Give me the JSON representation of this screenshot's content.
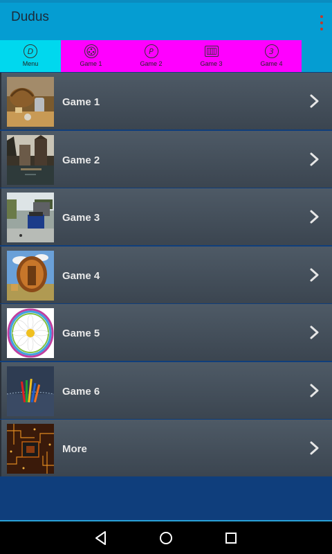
{
  "app": {
    "title": "Dudus"
  },
  "tabs": [
    {
      "label": "Menu",
      "icon_glyph": "D",
      "icon": "circle-d-icon"
    },
    {
      "label": "Game 1",
      "icon_glyph": "",
      "icon": "ball-icon"
    },
    {
      "label": "Game 2",
      "icon_glyph": "P",
      "icon": "circle-p-icon"
    },
    {
      "label": "Game 3",
      "icon_glyph": "",
      "icon": "grid-icon"
    },
    {
      "label": "Game 4",
      "icon_glyph": "3",
      "icon": "circle-3-icon"
    }
  ],
  "list": [
    {
      "label": "Game 1",
      "thumb": "basket-picnic-image"
    },
    {
      "label": "Game 2",
      "thumb": "canal-town-image"
    },
    {
      "label": "Game 3",
      "thumb": "street-cart-image"
    },
    {
      "label": "Game 4",
      "thumb": "barrel-sauna-image"
    },
    {
      "label": "Game 5",
      "thumb": "daisy-image"
    },
    {
      "label": "Game 6",
      "thumb": "pencils-jeans-image"
    },
    {
      "label": "More",
      "thumb": "circuit-board-image"
    }
  ],
  "colors": {
    "appbar": "#059dd2",
    "tab_active": "#00d8ee",
    "tab_inactive": "#ff00ff",
    "row_bg": "#465260",
    "overflow_dots": "#c0392b"
  }
}
